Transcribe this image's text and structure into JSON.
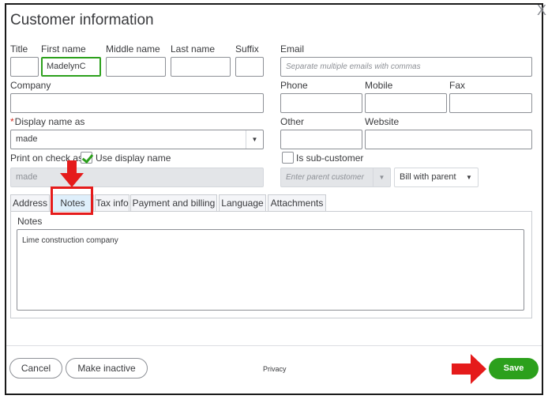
{
  "dialog": {
    "title": "Customer information",
    "close_glyph": "X"
  },
  "name": {
    "title_label": "Title",
    "first_label": "First name",
    "first_value": "MadelynC",
    "middle_label": "Middle name",
    "last_label": "Last name",
    "suffix_label": "Suffix"
  },
  "company": {
    "label": "Company"
  },
  "display_name": {
    "label": "Display name as",
    "required_mark": "*",
    "value": "made"
  },
  "print_on_check": {
    "label": "Print on check as",
    "checkbox_label": "Use display name",
    "checked": true,
    "value": "made"
  },
  "email": {
    "label": "Email",
    "placeholder": "Separate multiple emails with commas"
  },
  "phone": {
    "phone_label": "Phone",
    "mobile_label": "Mobile",
    "fax_label": "Fax"
  },
  "other": {
    "other_label": "Other",
    "website_label": "Website"
  },
  "sub_customer": {
    "checkbox_label": "Is sub-customer",
    "parent_placeholder": "Enter parent customer",
    "bill_option": "Bill with parent"
  },
  "tabs": [
    {
      "label": "Address"
    },
    {
      "label": "Notes"
    },
    {
      "label": "Tax info"
    },
    {
      "label": "Payment and billing"
    },
    {
      "label": "Language"
    },
    {
      "label": "Attachments"
    }
  ],
  "active_tab": "Notes",
  "notes": {
    "label": "Notes",
    "value": "Lime construction company"
  },
  "footer": {
    "cancel_label": "Cancel",
    "make_inactive_label": "Make inactive",
    "privacy_label": "Privacy",
    "save_label": "Save"
  },
  "colors": {
    "accent_green": "#2ca01c",
    "annotation_red": "#e51b1b",
    "active_tab_bg": "#dfeffb"
  },
  "icons": {
    "dropdown": "chevron-down-icon",
    "checkmark": "check-icon",
    "annotation_arrow": "red-arrow-icon"
  }
}
